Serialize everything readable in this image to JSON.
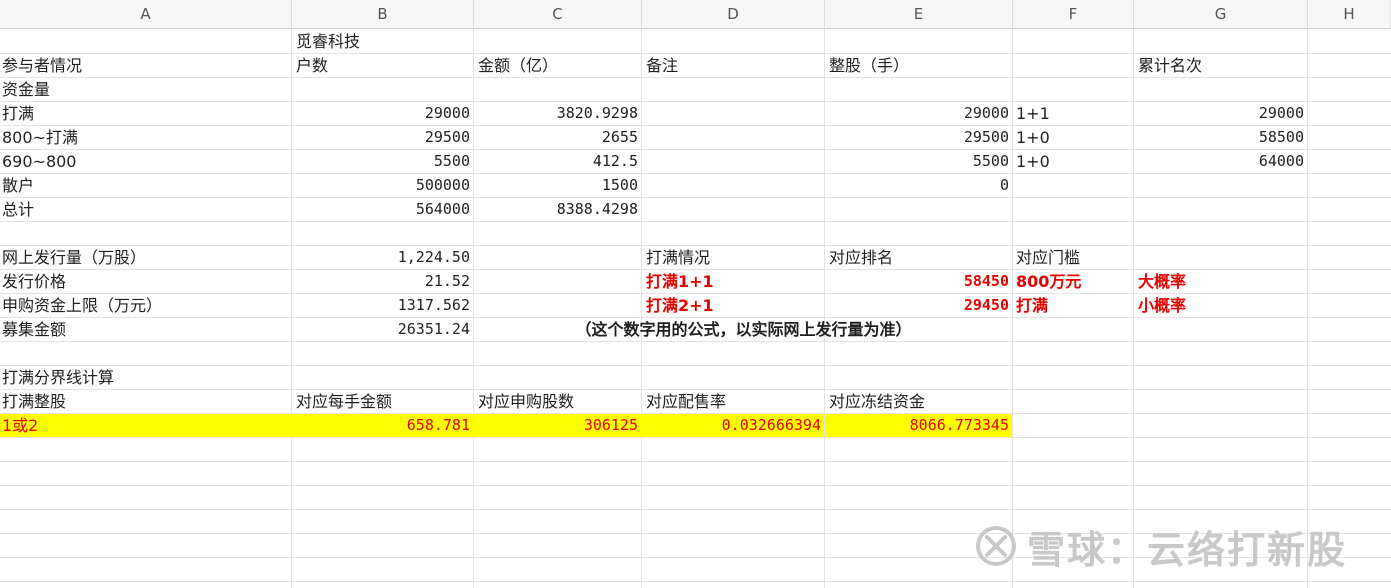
{
  "columns": [
    "A",
    "B",
    "C",
    "D",
    "E",
    "F",
    "G",
    "H"
  ],
  "colors": {
    "highlight": "#ffff00",
    "alert_red": "#e60000",
    "grid": "#e3e3e3"
  },
  "r2": {
    "b": "觅睿科技"
  },
  "r3": {
    "a": "参与者情况",
    "b": "户数",
    "c": "金额（亿）",
    "d": "备注",
    "e": "整股（手）",
    "g": "累计名次"
  },
  "r4": {
    "a": "资金量"
  },
  "r5": {
    "a": "打满",
    "b": "29000",
    "c": "3820.9298",
    "e": "29000",
    "f": "1+1",
    "g": "29000"
  },
  "r6": {
    "a": "800~打满",
    "b": "29500",
    "c": "2655",
    "e": "29500",
    "f": "1+0",
    "g": "58500"
  },
  "r7": {
    "a": "690~800",
    "b": "5500",
    "c": "412.5",
    "e": "5500",
    "f": "1+0",
    "g": "64000"
  },
  "r8": {
    "a": "散户",
    "b": "500000",
    "c": "1500",
    "e": "0"
  },
  "r9": {
    "a": "总计",
    "b": "564000",
    "c": "8388.4298"
  },
  "r11": {
    "a": "网上发行量（万股）",
    "b": "1,224.50",
    "d": "打满情况",
    "e": "对应排名",
    "f": "对应门槛"
  },
  "r12": {
    "a": "发行价格",
    "b": "21.52",
    "d": "打满1+1",
    "e": "58450",
    "f": "800万元",
    "g": "大概率"
  },
  "r13": {
    "a": "申购资金上限（万元）",
    "b": "1317.562",
    "d": "打满2+1",
    "e": "29450",
    "f": "打满",
    "g": "小概率"
  },
  "r14": {
    "a": "募集金额",
    "b": "26351.24",
    "c": "（这个数字用的公式，以实际网上发行量为准）"
  },
  "r16": {
    "a": "打满分界线计算"
  },
  "r17": {
    "a": "打满整股",
    "b": "对应每手金额",
    "c": "对应申购股数",
    "d": "对应配售率",
    "e": "对应冻结资金"
  },
  "r18": {
    "a": "1或2",
    "b": "658.781",
    "c": "306125",
    "d": "0.032666394",
    "e": "8066.773345"
  },
  "watermark": {
    "text": "雪球：云络打新股",
    "logo": "snowball-logo-icon"
  }
}
